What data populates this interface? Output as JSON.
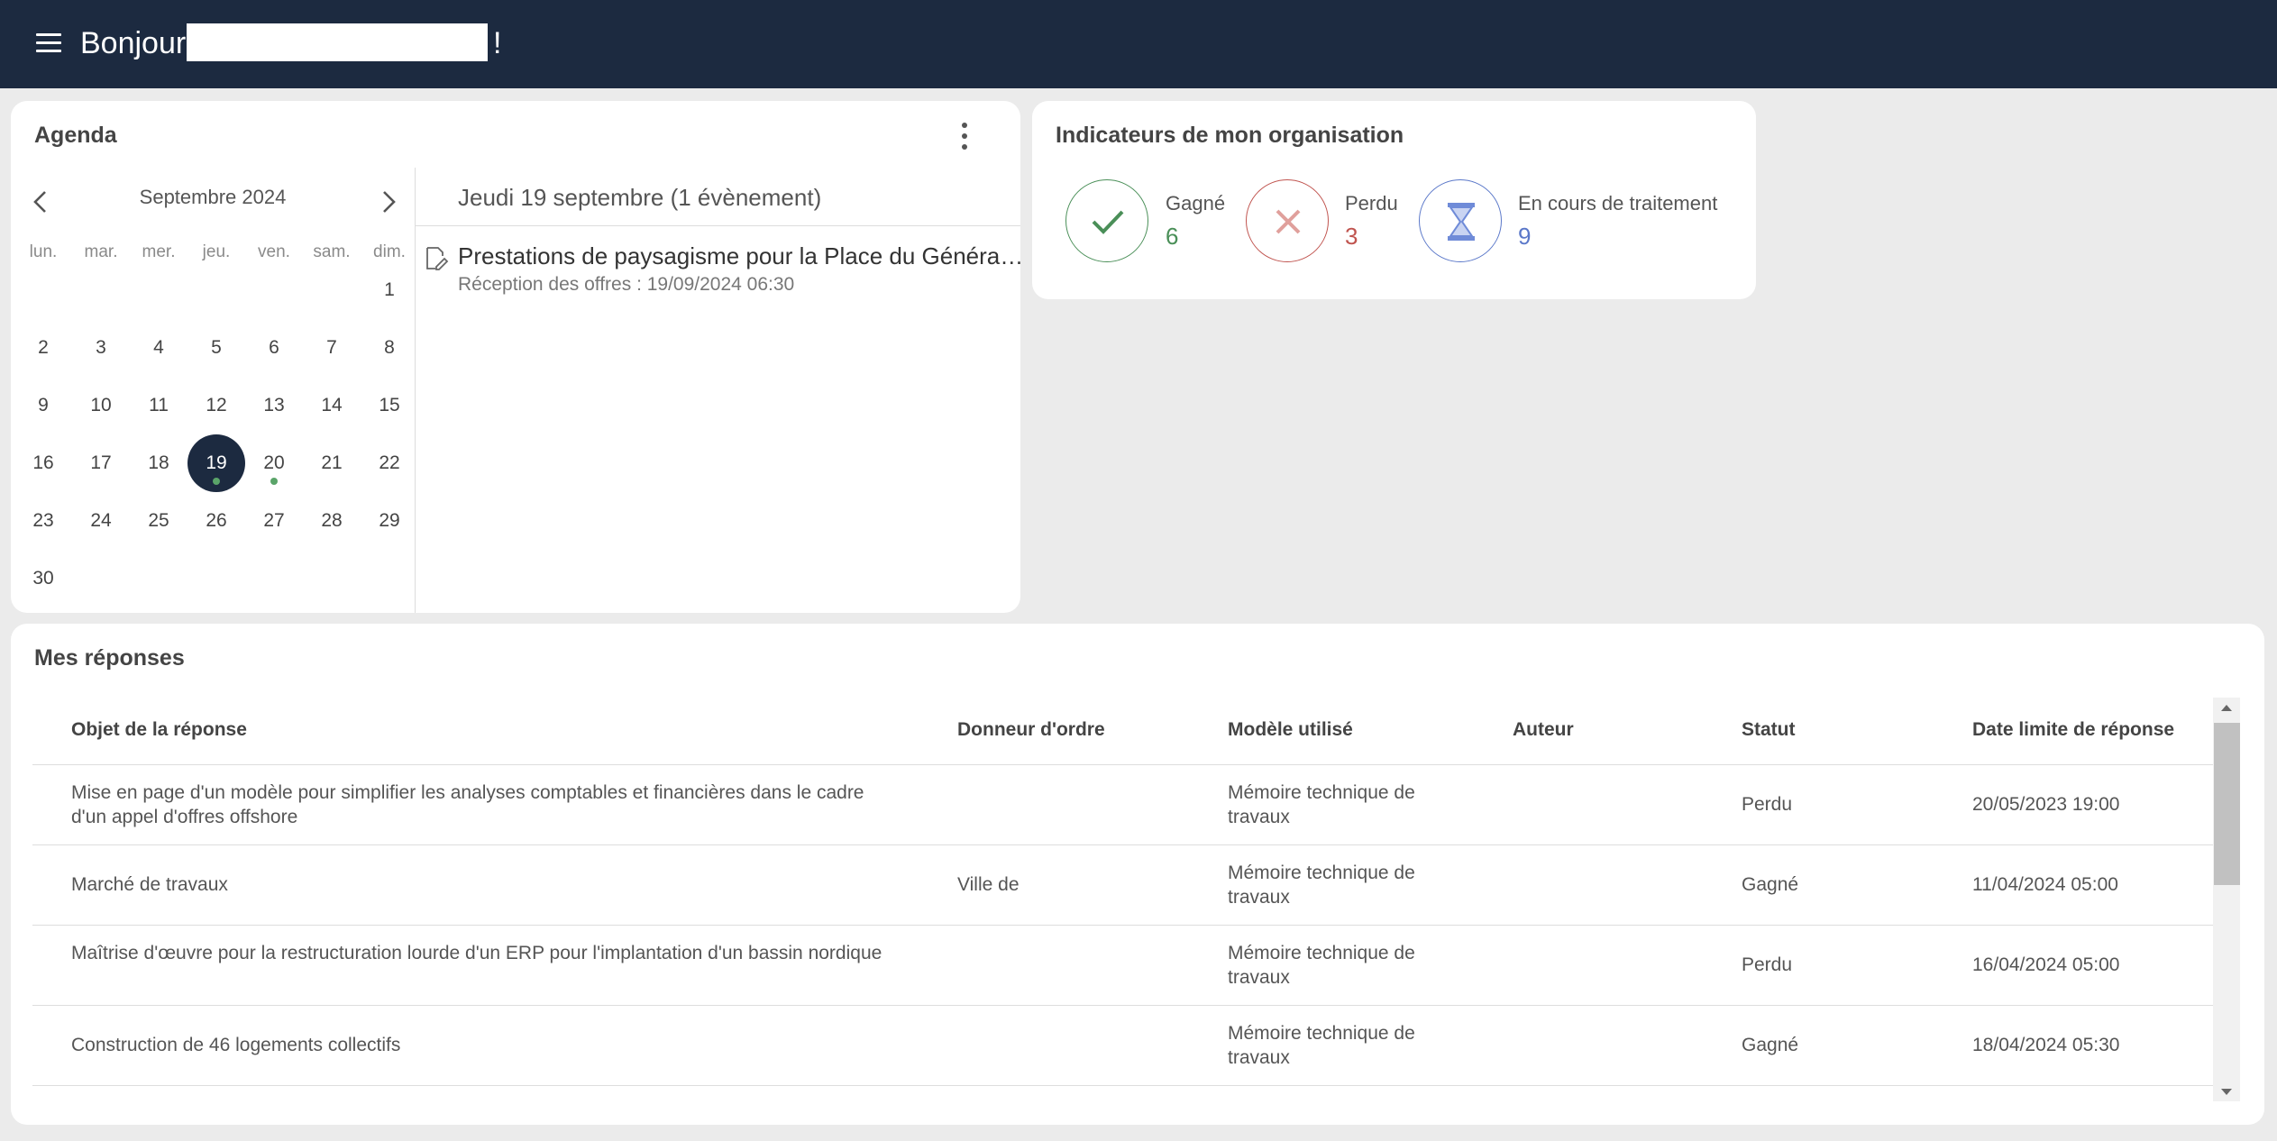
{
  "header": {
    "greeting": "Bonjour",
    "exclamation": "!"
  },
  "agenda": {
    "title": "Agenda",
    "month": "Septembre 2024",
    "weekdays": [
      "lun.",
      "mar.",
      "mer.",
      "jeu.",
      "ven.",
      "sam.",
      "dim."
    ],
    "days": [
      "1",
      "2",
      "3",
      "4",
      "5",
      "6",
      "7",
      "8",
      "9",
      "10",
      "11",
      "12",
      "13",
      "14",
      "15",
      "16",
      "17",
      "18",
      "19",
      "20",
      "21",
      "22",
      "23",
      "24",
      "25",
      "26",
      "27",
      "28",
      "29",
      "30"
    ],
    "selected_day": "19",
    "event_days": [
      "19",
      "20"
    ],
    "selected_date_label": "Jeudi 19 septembre (1 évènement)",
    "event": {
      "title": "Prestations de paysagisme pour la Place du Général ...",
      "subtitle": "Réception des offres :  19/09/2024 06:30"
    }
  },
  "indicators": {
    "title": "Indicateurs de mon organisation",
    "items": [
      {
        "label": "Gagné",
        "value": "6",
        "color": "#4a8f58",
        "icon": "check-icon"
      },
      {
        "label": "Perdu",
        "value": "3",
        "color": "#c0544f",
        "icon": "close-icon"
      },
      {
        "label": "En cours de traitement",
        "value": "9",
        "color": "#5b78c9",
        "icon": "hourglass-icon"
      }
    ]
  },
  "responses": {
    "title": "Mes réponses",
    "columns": [
      "Objet de la réponse",
      "Donneur d'ordre",
      "Modèle utilisé",
      "Auteur",
      "Statut",
      "Date limite de réponse"
    ],
    "rows": [
      {
        "objet": "Mise en page d'un modèle pour simplifier les analyses comptables et financières dans le cadre d'un appel d'offres offshore",
        "donneur": "",
        "modele": "Mémoire technique de travaux",
        "auteur": "",
        "statut": "Perdu",
        "date": "20/05/2023 19:00"
      },
      {
        "objet": "Marché de travaux",
        "donneur": "Ville de",
        "modele": "Mémoire technique de travaux",
        "auteur": "",
        "statut": "Gagné",
        "date": "11/04/2024 05:00"
      },
      {
        "objet": "Maîtrise d'œuvre pour la restructuration lourde d'un ERP pour l'implantation d'un bassin nordique",
        "donneur": "",
        "modele": "Mémoire technique de travaux",
        "auteur": "",
        "statut": "Perdu",
        "date": "16/04/2024 05:00"
      },
      {
        "objet": "Construction de 46 logements collectifs",
        "donneur": "",
        "modele": "Mémoire technique de travaux",
        "auteur": "",
        "statut": "Gagné",
        "date": "18/04/2024 05:30"
      }
    ]
  },
  "colors": {
    "header_bg": "#1c2a40",
    "page_bg": "#ebebeb",
    "won": "#4a8f58",
    "lost": "#c0544f",
    "pending": "#5b78c9",
    "event_dot": "#5aa469"
  }
}
